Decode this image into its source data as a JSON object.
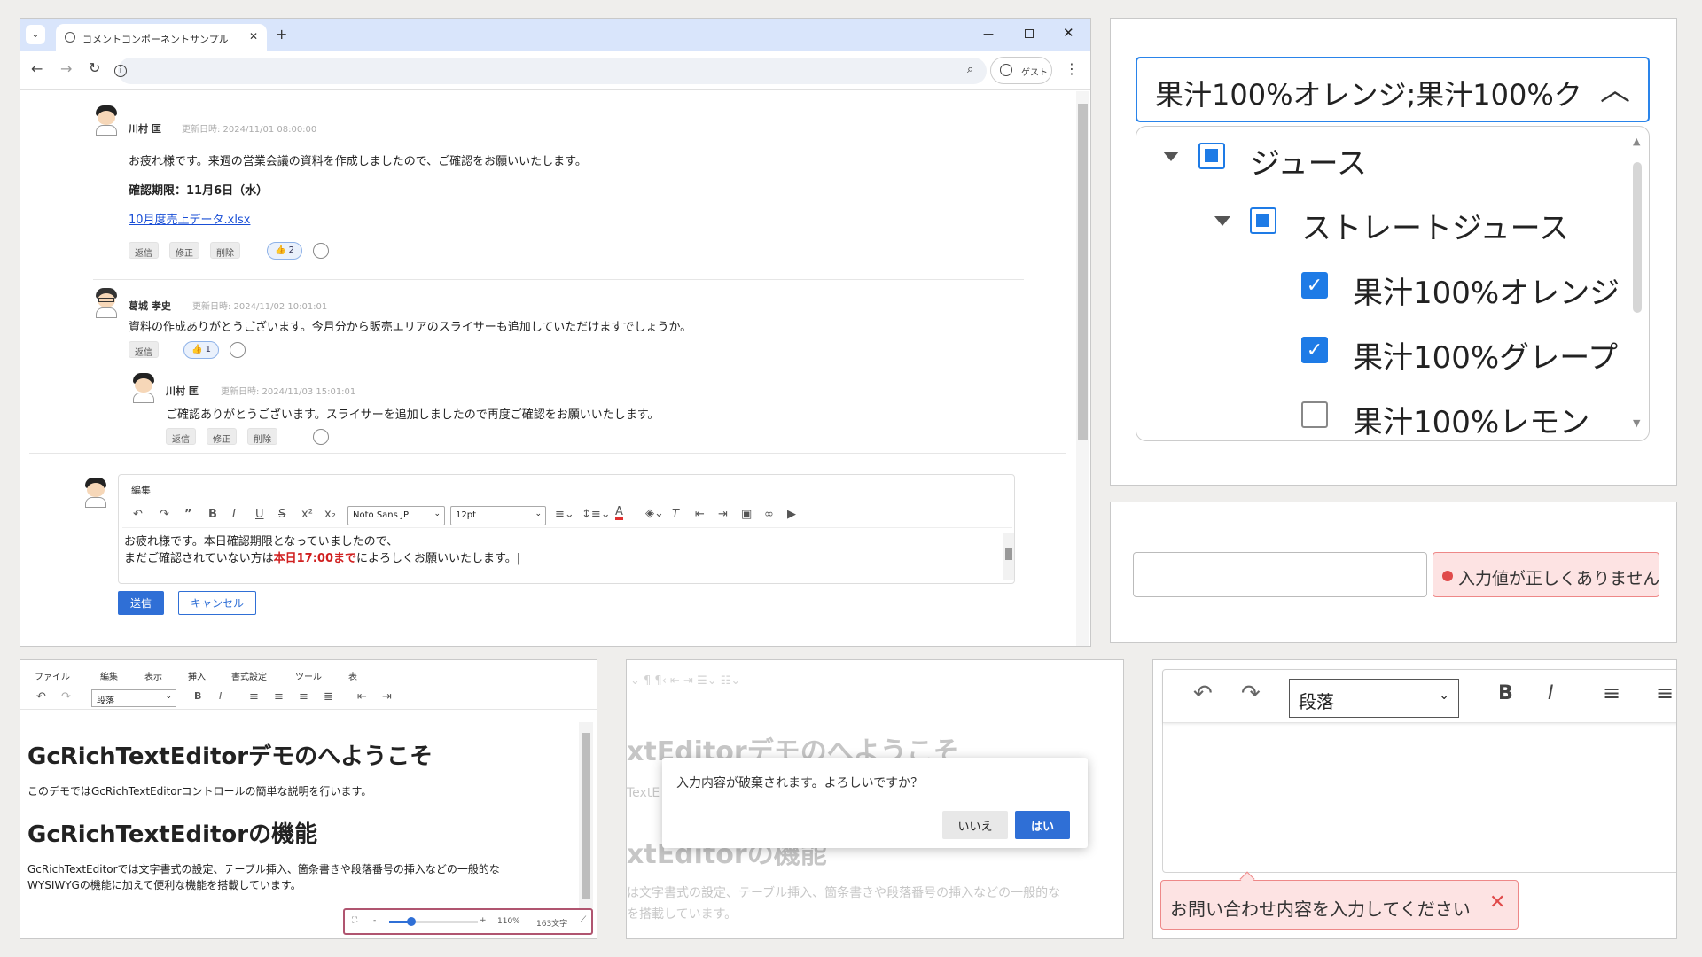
{
  "browser": {
    "tab_title": "コメントコンポーネントサンプル",
    "new_tab": "+",
    "guest": "ゲスト"
  },
  "comments": [
    {
      "name": "川村 匡",
      "date": "更新日時: 2024/11/01 08:00:00",
      "body": "お疲れ様です。来週の営業会議の資料を作成しましたので、ご確認をお願いいたします。",
      "deadline": "確認期限：11月6日（水）",
      "link": "10月度売上データ.xlsx",
      "reply": "返信",
      "edit": "修正",
      "delete": "削除",
      "reaction": "👍 2"
    },
    {
      "name": "葛城 孝史",
      "date": "更新日時: 2024/11/02 10:01:01",
      "body": "資料の作成ありがとうございます。今月分から販売エリアのスライサーも追加していただけますでしょうか。",
      "reply": "返信",
      "reaction": "👍 1"
    },
    {
      "name": "川村 匡",
      "date": "更新日時: 2024/11/03 15:01:01",
      "body": "ご確認ありがとうございます。スライサーを追加しましたので再度ご確認をお願いいたします。",
      "reply": "返信",
      "edit": "修正",
      "delete": "削除"
    }
  ],
  "editor": {
    "title": "編集",
    "font": "Noto Sans JP",
    "size": "12pt",
    "line1": "お疲れ様です。本日確認期限となっていましたので、",
    "line2a": "まだご確認されていない方は",
    "line2b": "本日17:00まで",
    "line2c": "によろしくお願いいたします。",
    "send": "送信",
    "cancel": "キャンセル"
  },
  "tree": {
    "value": "果汁100%オレンジ;果汁100%ク",
    "items": [
      {
        "label": "ジュース",
        "state": "partial"
      },
      {
        "label": "ストレートジュース",
        "state": "partial"
      },
      {
        "label": "果汁100%オレンジ",
        "state": "checked"
      },
      {
        "label": "果汁100%グレープ",
        "state": "checked"
      },
      {
        "label": "果汁100%レモン",
        "state": "unchecked"
      }
    ]
  },
  "validation": {
    "error": "入力値が正しくありません"
  },
  "rte": {
    "menus": [
      "ファイル",
      "編集",
      "表示",
      "挿入",
      "書式設定",
      "ツール",
      "表"
    ],
    "block": "段落",
    "h1": "GcRichTextEditorデモのへようこそ",
    "p1": "このデモではGcRichTextEditorコントロールの簡単な説明を行います。",
    "h2": "GcRichTextEditorの機能",
    "p2a": "GcRichTextEditorでは文字書式の設定、テーブル挿入、箇条書きや段落番号の挿入などの一般的な",
    "p2b": "WYSIWYGの機能に加えて便利な機能を搭載しています。",
    "zoom": "110%",
    "count": "163文字"
  },
  "dialog": {
    "bg_h1": "xtEditorデモのへようこそ",
    "bg_h2": "xtEditorの機能",
    "bg_p1": "TextE",
    "bg_p2a": "は文字書式の設定、テーブル挿入、箇条書きや段落番号の挿入などの一般的な",
    "bg_p2b": "を搭載しています。",
    "message": "入力内容が破棄されます。よろしいですか？",
    "no": "いいえ",
    "yes": "はい"
  },
  "tooltip": {
    "block": "段落",
    "error": "お問い合わせ内容を入力してください"
  },
  "colors": {
    "accent": "#1e7be6",
    "primary_button": "#2f6fd6",
    "error": "#e04a4a"
  }
}
